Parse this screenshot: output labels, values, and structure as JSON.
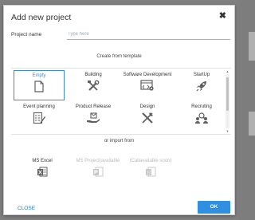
{
  "dialog": {
    "title": "Add new project",
    "close_glyph": "✖"
  },
  "project_name": {
    "label": "Project name",
    "placeholder": "Type here",
    "value": ""
  },
  "templates": {
    "heading": "Create from template",
    "items": [
      {
        "label": "Empty",
        "icon": "document-icon",
        "selected": true
      },
      {
        "label": "Building",
        "icon": "tools-icon",
        "selected": false
      },
      {
        "label": "Software Development",
        "icon": "code-window-icon",
        "selected": false
      },
      {
        "label": "StartUp",
        "icon": "rocket-icon",
        "selected": false
      },
      {
        "label": "Event planning",
        "icon": "checklist-icon",
        "selected": false
      },
      {
        "label": "Product Release",
        "icon": "hand-box-icon",
        "selected": false
      },
      {
        "label": "Design",
        "icon": "design-tools-icon",
        "selected": false
      },
      {
        "label": "Recruting",
        "icon": "people-search-icon",
        "selected": false
      }
    ]
  },
  "import": {
    "heading": "or import from",
    "items": [
      {
        "label": "MS Excel",
        "icon": "excel-icon",
        "enabled": true
      },
      {
        "label": "MS Project(available",
        "icon": "project-icon",
        "enabled": false
      },
      {
        "label": "(Callavailable soon)",
        "icon": "calendar-icon",
        "enabled": false
      }
    ]
  },
  "footer": {
    "cancel_label": "CLOSE",
    "ok_label": "OK"
  },
  "colors": {
    "accent": "#2f8fe0",
    "icon": "#5f5f5f",
    "disabled": "#c8c8c8"
  }
}
